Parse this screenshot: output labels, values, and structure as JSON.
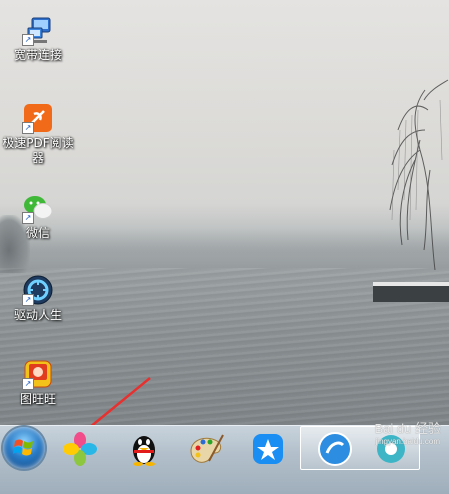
{
  "desktop": {
    "icons": [
      {
        "label": "宽带连接",
        "icon": "network-connection-icon"
      },
      {
        "label": "极速PDF阅读器",
        "icon": "pdf-reader-icon"
      },
      {
        "label": "微信",
        "icon": "wechat-icon"
      },
      {
        "label": "驱动人生",
        "icon": "driver-manager-icon"
      },
      {
        "label": "图旺旺",
        "icon": "image-viewer-icon"
      }
    ]
  },
  "taskbar": {
    "pinned": [
      {
        "name": "start-button",
        "icon": "windows-logo-icon"
      },
      {
        "name": "taskbar-pinwheel-app",
        "icon": "pinwheel-icon"
      },
      {
        "name": "taskbar-qq",
        "icon": "qq-penguin-icon"
      },
      {
        "name": "taskbar-paint",
        "icon": "paint-palette-icon"
      },
      {
        "name": "taskbar-dingtalk",
        "icon": "blue-star-icon"
      },
      {
        "name": "taskbar-active-app",
        "icon": "round-app-icon"
      }
    ]
  },
  "watermark": {
    "text": "Bai du 经验",
    "sub": "jingyan.baidu.com"
  },
  "colors": {
    "annotation_arrow": "#e8302f",
    "taskbar": "#b3c0cb"
  }
}
